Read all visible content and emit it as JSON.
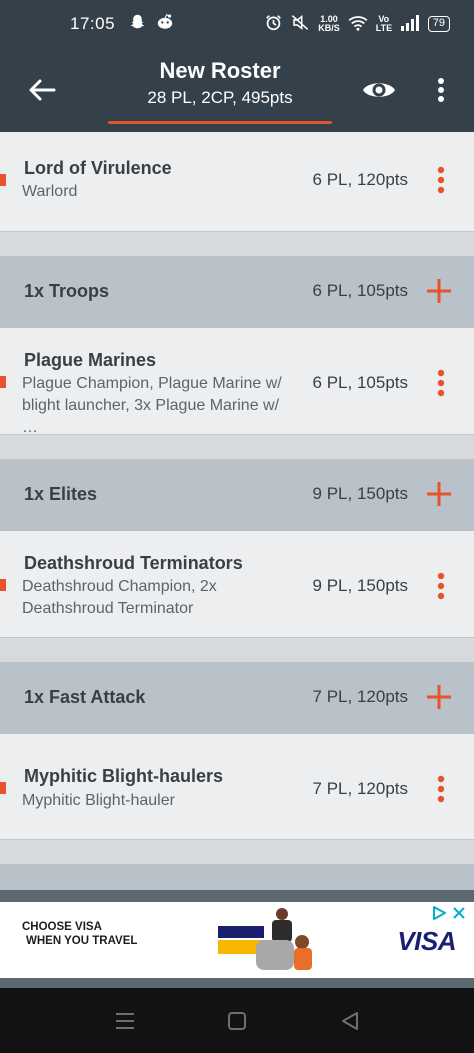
{
  "status_bar": {
    "time": "17:05",
    "speed_top": "1.00",
    "speed_bottom": "KB/S",
    "network": "Vo LTE",
    "battery": "79",
    "icons": [
      "snapchat-icon",
      "reddit-icon",
      "alarm-icon",
      "mute-icon",
      "wifi-icon",
      "signal-icon",
      "battery-icon"
    ]
  },
  "app_bar": {
    "title": "New Roster",
    "subtitle": "28 PL, 2CP, 495pts",
    "accent_color": "#e8532b",
    "icons": [
      "back-arrow-icon",
      "eye-icon",
      "more-vert-icon"
    ]
  },
  "roster": {
    "hq_unit": {
      "name": "Lord of Virulence",
      "desc": "Warlord",
      "pts": "6 PL, 120pts"
    },
    "troops": {
      "header": {
        "label": "1x Troops",
        "pts": "6 PL, 105pts"
      },
      "unit": {
        "name": "Plague Marines",
        "desc": "Plague Champion, Plague Marine w/ blight launcher, 3x Plague Marine w/ …",
        "pts": "6 PL, 105pts"
      }
    },
    "elites": {
      "header": {
        "label": "1x Elites",
        "pts": "9 PL, 150pts"
      },
      "unit": {
        "name": "Deathshroud Terminators",
        "desc": "Deathshroud Champion, 2x Deathshroud Terminator",
        "pts": "9 PL, 150pts"
      }
    },
    "fast_attack": {
      "header": {
        "label": "1x Fast Attack",
        "pts": "7 PL, 120pts"
      },
      "unit": {
        "name": "Myphitic Blight-haulers",
        "desc": "Myphitic Blight-hauler",
        "pts": "7 PL, 120pts"
      }
    }
  },
  "ad": {
    "line1": "CHOOSE VISA",
    "line2": "WHEN YOU TRAVEL",
    "brand": "VISA"
  },
  "nav": {
    "icons": [
      "recents-icon",
      "home-icon",
      "back-triangle-icon"
    ]
  }
}
